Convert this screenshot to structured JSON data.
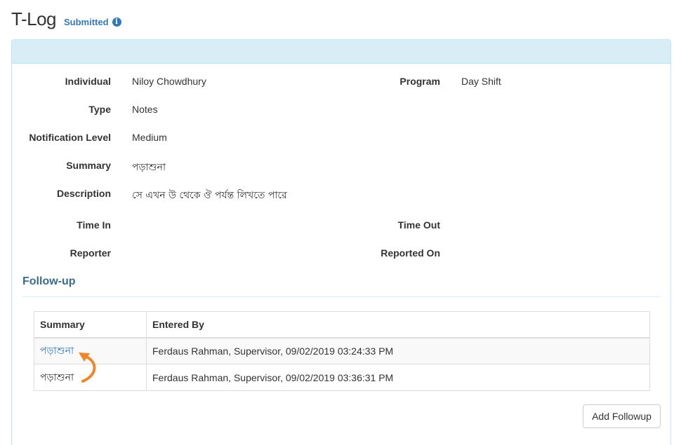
{
  "header": {
    "title": "T-Log",
    "status": "Submitted",
    "status_icon": "info-circle-icon"
  },
  "details": {
    "individual_label": "Individual",
    "individual_value": "Niloy Chowdhury",
    "program_label": "Program",
    "program_value": "Day Shift",
    "type_label": "Type",
    "type_value": "Notes",
    "notification_label": "Notification Level",
    "notification_value": "Medium",
    "summary_label": "Summary",
    "summary_value": "পড়াশুনা",
    "description_label": "Description",
    "description_value": "সে এখন উ থেকে ঔ পর্যন্ত লিখতে পারে",
    "time_in_label": "Time In",
    "time_in_value": "",
    "time_out_label": "Time Out",
    "time_out_value": "",
    "reporter_label": "Reporter",
    "reporter_value": "",
    "reported_on_label": "Reported On",
    "reported_on_value": ""
  },
  "followup": {
    "title": "Follow-up",
    "columns": [
      "Summary",
      "Entered By"
    ],
    "rows": [
      {
        "summary": "পড়াশুনা",
        "entered_by": "Ferdaus Rahman, Supervisor, 09/02/2019 03:24:33 PM"
      },
      {
        "summary": "পড়াশুনা",
        "entered_by": "Ferdaus Rahman, Supervisor, 09/02/2019 03:36:31 PM"
      }
    ],
    "add_button": "Add Followup"
  },
  "colors": {
    "accent": "#337ab7",
    "panel_heading": "#d9edf7",
    "annotation_arrow": "#f0862a"
  }
}
